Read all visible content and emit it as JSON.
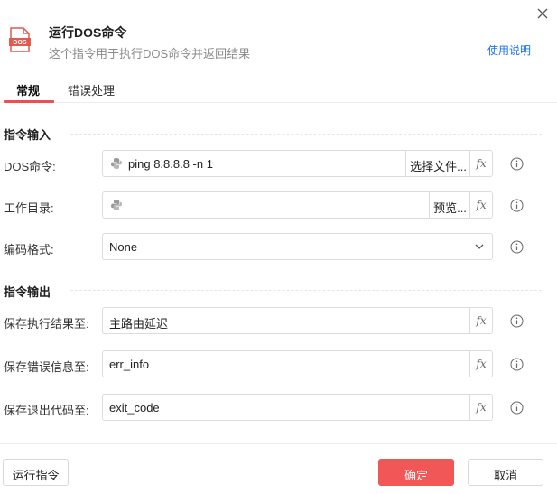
{
  "header": {
    "icon": "dos-file-icon",
    "icon_text": "DOS",
    "title": "运行DOS命令",
    "subtitle": "这个指令用于执行DOS命令并返回结果",
    "help_link": "使用说明"
  },
  "tabs": [
    {
      "label": "常规",
      "active": true
    },
    {
      "label": "错误处理",
      "active": false
    }
  ],
  "sections": {
    "input_title": "指令输入",
    "output_title": "指令输出"
  },
  "fields": {
    "dos_command": {
      "label": "DOS命令:",
      "value": "ping 8.8.8.8 -n 1",
      "button": "选择文件...",
      "fx": "fx"
    },
    "work_dir": {
      "label": "工作目录:",
      "value": "",
      "button": "预览...",
      "fx": "fx"
    },
    "encoding": {
      "label": "编码格式:",
      "value": "None"
    },
    "save_result": {
      "label": "保存执行结果至:",
      "value": "主路由延迟",
      "fx": "fx"
    },
    "save_error": {
      "label": "保存错误信息至:",
      "value": "err_info",
      "fx": "fx"
    },
    "save_exit_code": {
      "label": "保存退出代码至:",
      "value": "exit_code",
      "fx": "fx"
    }
  },
  "footer": {
    "run_label": "运行指令",
    "ok_label": "确定",
    "cancel_label": "取消"
  },
  "colors": {
    "accent": "#f25757",
    "link": "#1a73e8",
    "border": "#dcdcdc"
  }
}
